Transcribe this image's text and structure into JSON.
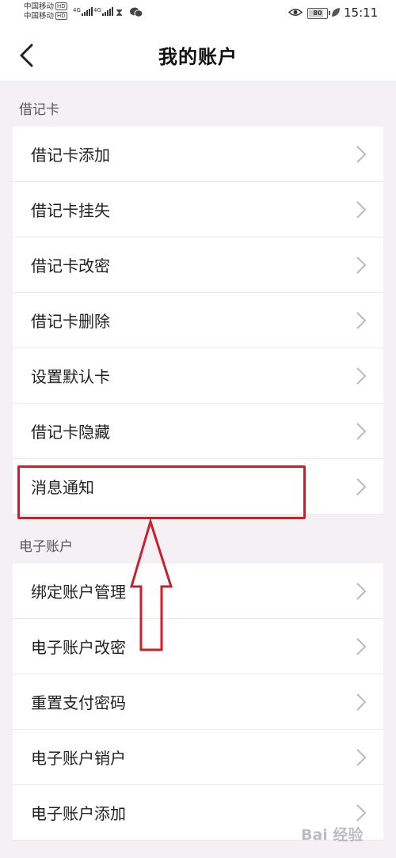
{
  "status_bar": {
    "carrier_1": "中国移动",
    "carrier_2": "中国移动",
    "hd_badge": "HD",
    "network_1": "4G",
    "network_2": "4G",
    "battery": "80",
    "battery_level": 0.8,
    "time": "15:11"
  },
  "header": {
    "title": "我的账户"
  },
  "sections": [
    {
      "label": "借记卡",
      "items": [
        {
          "label": "借记卡添加"
        },
        {
          "label": "借记卡挂失"
        },
        {
          "label": "借记卡改密"
        },
        {
          "label": "借记卡删除"
        },
        {
          "label": "设置默认卡"
        },
        {
          "label": "借记卡隐藏"
        },
        {
          "label": "消息通知"
        }
      ]
    },
    {
      "label": "电子账户",
      "items": [
        {
          "label": "绑定账户管理"
        },
        {
          "label": "电子账户改密"
        },
        {
          "label": "重置支付密码"
        },
        {
          "label": "电子账户销户"
        },
        {
          "label": "电子账户添加"
        }
      ]
    }
  ],
  "watermark": {
    "text": "Bai 经验"
  },
  "colors": {
    "highlight": "#c8202c",
    "background": "#f4f0f4"
  }
}
